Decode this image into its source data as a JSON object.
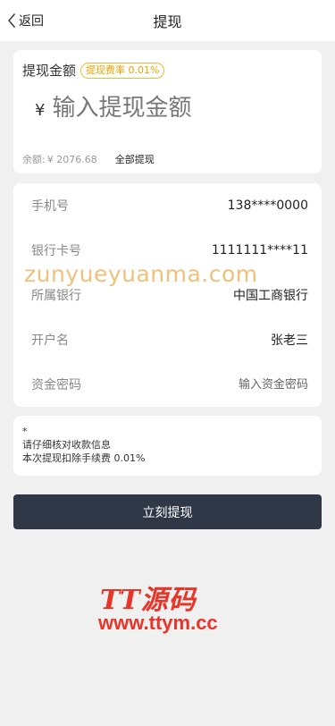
{
  "header": {
    "back_label": "返回",
    "title": "提现"
  },
  "amount": {
    "label": "提现金额",
    "fee_badge": "提现费率 0.01%",
    "currency": "¥",
    "placeholder": "输入提现金额",
    "balance_label": "余额:",
    "balance_value": "¥ 2076.68",
    "withdraw_all": "全部提现"
  },
  "info": {
    "rows": [
      {
        "label": "手机号",
        "value": "138****0000"
      },
      {
        "label": "银行卡号",
        "value": "1111111****11"
      },
      {
        "label": "所属银行",
        "value": "中国工商银行"
      },
      {
        "label": "开户名",
        "value": "张老三"
      },
      {
        "label": "资金密码",
        "placeholder": "输入资金密码"
      }
    ]
  },
  "note": {
    "star": "*",
    "line1": "请仔细核对收款信息",
    "line2": "本次提现扣除手续费 0.01%"
  },
  "submit_label": "立刻提现",
  "watermarks": {
    "mid": "zunyueyuanma.com",
    "logo": "TT源码",
    "url": "www.ttym.cc"
  },
  "colors": {
    "button": "#303848",
    "fee_accent": "#e8a200",
    "watermark_red": "#e8352a"
  }
}
